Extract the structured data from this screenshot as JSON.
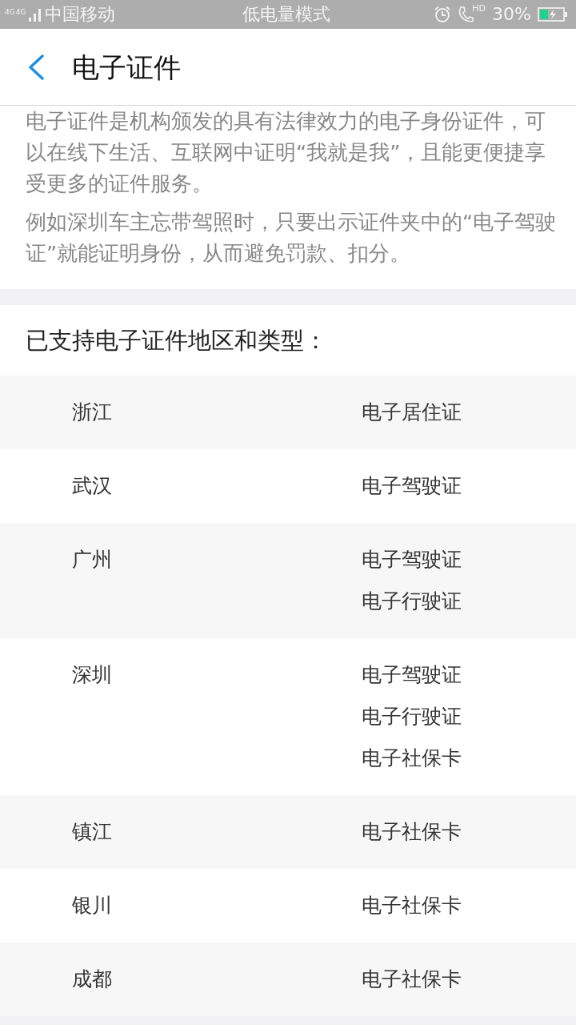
{
  "status_bar": {
    "network_types": [
      "4G",
      "4G"
    ],
    "carrier": "中国移动",
    "mode": "低电量模式",
    "call_badge": "HD",
    "battery_percent": "30%",
    "charging": true
  },
  "header": {
    "title": "电子证件"
  },
  "intro": {
    "paragraphs": [
      "电子证件是机构颁发的具有法律效力的电子身份证件，可以在线下生活、互联网中证明“我就是我”，且能更便捷享受更多的证件服务。",
      "例如深圳车主忘带驾照时，只要出示证件夹中的“电子驾驶证”就能证明身份，从而避免罚款、扣分。"
    ]
  },
  "section": {
    "title": "已支持电子证件地区和类型：",
    "rows": [
      {
        "region": "浙江",
        "types": [
          "电子居住证"
        ]
      },
      {
        "region": "武汉",
        "types": [
          "电子驾驶证"
        ]
      },
      {
        "region": "广州",
        "types": [
          "电子驾驶证",
          "电子行驶证"
        ]
      },
      {
        "region": "深圳",
        "types": [
          "电子驾驶证",
          "电子行驶证",
          "电子社保卡"
        ]
      },
      {
        "region": "镇江",
        "types": [
          "电子社保卡"
        ]
      },
      {
        "region": "银川",
        "types": [
          "电子社保卡"
        ]
      },
      {
        "region": "成都",
        "types": [
          "电子社保卡"
        ]
      }
    ]
  }
}
